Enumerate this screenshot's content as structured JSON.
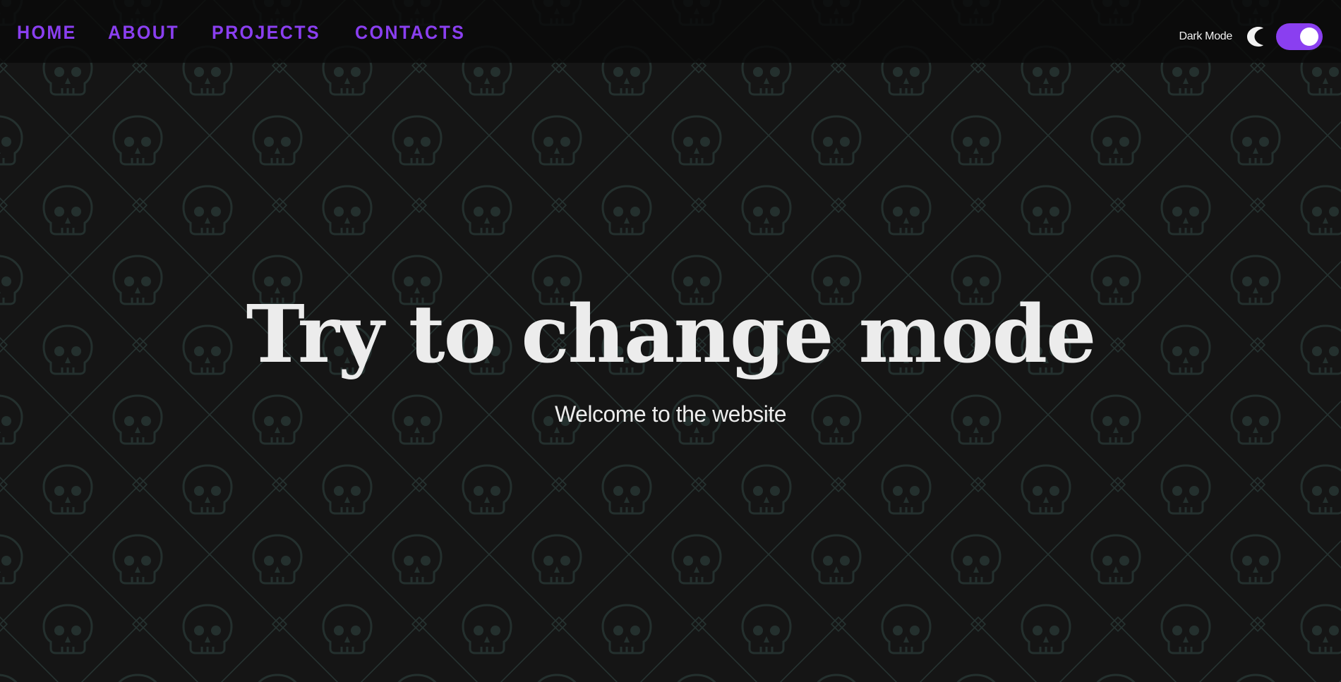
{
  "nav": {
    "items": [
      {
        "label": "HOME"
      },
      {
        "label": "ABOUT"
      },
      {
        "label": "PROJECTS"
      },
      {
        "label": "CONTACTS"
      }
    ]
  },
  "mode_toggle": {
    "label": "Dark Mode",
    "icon": "moon-icon",
    "state": "on"
  },
  "hero": {
    "title": "Try to change mode",
    "subtitle": "Welcome to the website"
  },
  "colors": {
    "accent": "#8a3ff0",
    "background": "#151515",
    "pattern": "#243230",
    "text": "#ececec"
  }
}
